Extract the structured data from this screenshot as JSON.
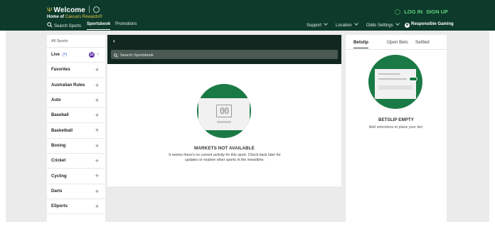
{
  "header": {
    "welcome": "Welcome",
    "home_of": "Home of",
    "caesars_rewards": "Caesars Rewards®",
    "login": "LOG IN",
    "signup": "SIGN UP"
  },
  "nav": {
    "search": "Search Sports",
    "sportsbook": "Sportsbook",
    "promotions": "Promotions",
    "support": "Support",
    "location": "Location",
    "odds_settings": "Odds Settings",
    "responsible_gaming": "Responsible Gaming"
  },
  "sidebar": {
    "all_sports": "All Sports",
    "live_label": "Live",
    "live_count": "12",
    "items": [
      {
        "label": "Favorites"
      },
      {
        "label": "Australian Rules"
      },
      {
        "label": "Auto"
      },
      {
        "label": "Baseball"
      },
      {
        "label": "Basketball"
      },
      {
        "label": "Boxing"
      },
      {
        "label": "Cricket"
      },
      {
        "label": "Cycling"
      },
      {
        "label": "Darts"
      },
      {
        "label": "ESports"
      }
    ]
  },
  "center": {
    "search_placeholder": "Search Sportsbook",
    "empty_title": "MARKETS NOT AVAILABLE",
    "empty_text": "It seems there's no current activity for this sport. Check back later for updates or explore other sports in the meantime.",
    "score_display": "00"
  },
  "betslip": {
    "tabs": [
      "Betslip",
      "Open Bets",
      "Settled"
    ],
    "empty_title": "BETSLIP EMPTY",
    "empty_hint": "Add selections to place your bet."
  },
  "colors": {
    "header_bg": "#0d3a2b",
    "accent_green": "#1a7a45",
    "login_green": "#5fd07a",
    "live_badge": "#5b2aa3"
  }
}
